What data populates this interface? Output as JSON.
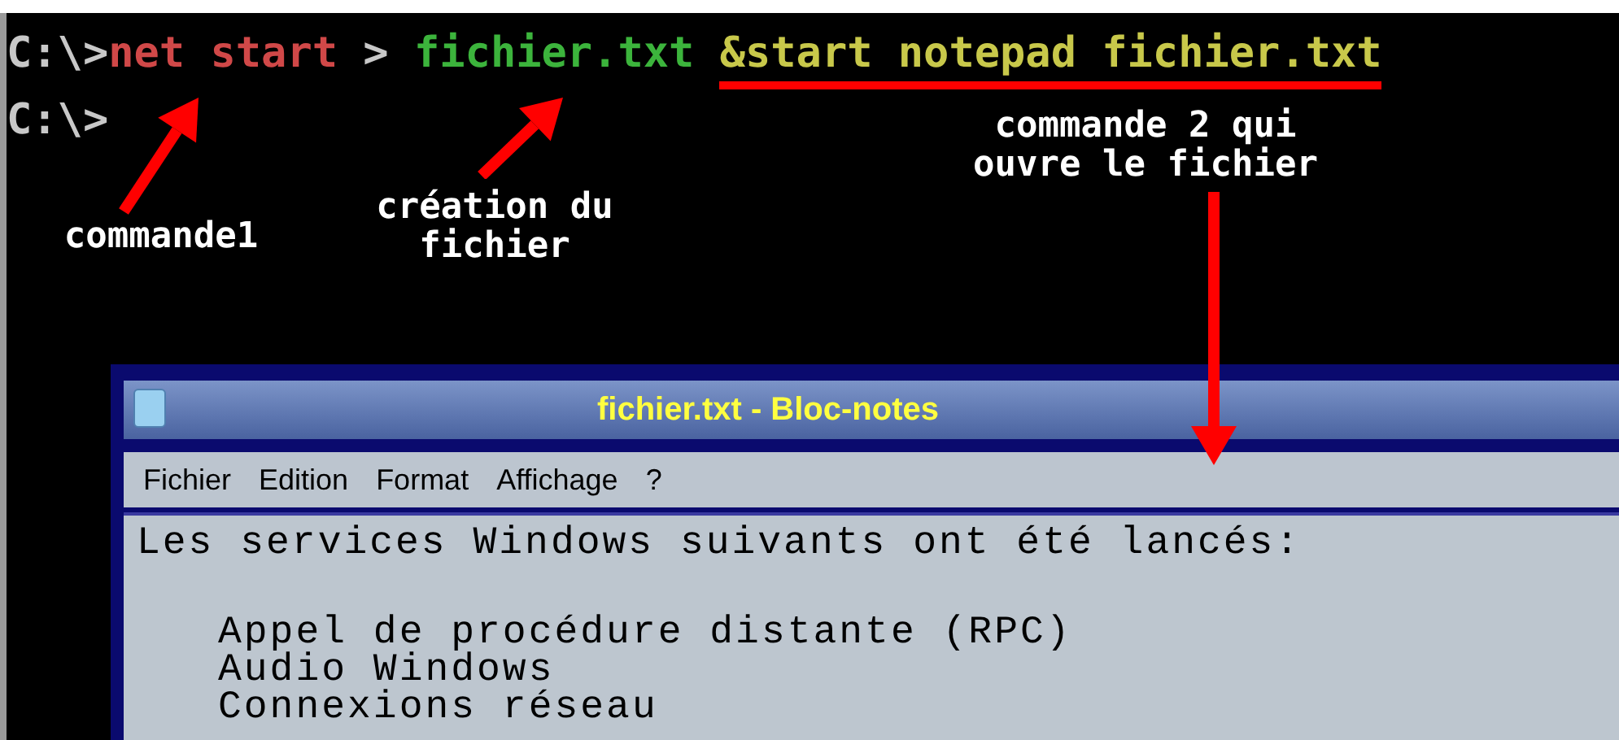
{
  "console": {
    "lines": [
      {
        "segments": [
          {
            "text": "C:\\>",
            "color": "#c8c8c8",
            "underlined": false
          },
          {
            "text": "net start",
            "color": "#d04848",
            "underlined": false
          },
          {
            "text": " > ",
            "color": "#c8c8c8",
            "underlined": false
          },
          {
            "text": "fichier.txt ",
            "color": "#3cb43c",
            "underlined": false
          },
          {
            "text": "&start notepad fichier.txt",
            "color": "#c8c84a",
            "underlined": true
          }
        ]
      },
      {
        "segments": [
          {
            "text": "C:\\>",
            "color": "#c8c8c8",
            "underlined": false
          }
        ]
      }
    ]
  },
  "annotations": [
    {
      "text": "commande1"
    },
    {
      "text": "création du fichier"
    },
    {
      "text": "commande 2 qui ouvre le fichier"
    }
  ],
  "notepad": {
    "title": "fichier.txt - Bloc-notes",
    "menu": [
      "Fichier",
      "Edition",
      "Format",
      "Affichage",
      "?"
    ],
    "heading": "Les services Windows suivants ont été lancés:",
    "items": [
      "Appel de procédure distante (RPC)",
      "Audio Windows",
      "Connexions réseau"
    ]
  }
}
